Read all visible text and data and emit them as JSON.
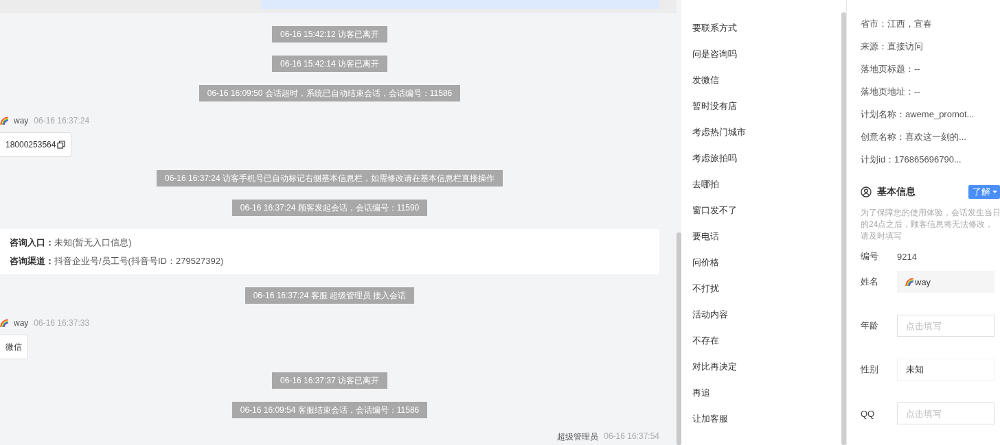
{
  "chat": {
    "messages": [
      {
        "kind": "system",
        "text": "06-16 15:42:12 访客已离开"
      },
      {
        "kind": "system",
        "text": "06-16 15:42:14 访客已离开"
      },
      {
        "kind": "system",
        "text": "06-16 16:09:50 会话超时，系统已自动结束会话，会话编号：11586"
      },
      {
        "kind": "visitor",
        "name": "way",
        "time": "06-16 16:37:24",
        "text": "18000253564",
        "copyable": true
      },
      {
        "kind": "system",
        "text": "06-16 16:37:24 访客手机号已自动标记右侧基本信息栏，如需修改请在基本信息栏直接操作"
      },
      {
        "kind": "system",
        "text": "06-16 16:37:24 顾客发起会话，会话编号：11590"
      },
      {
        "kind": "info",
        "rows": [
          {
            "label": "咨询入口：",
            "value": "未知(暂无入口信息)"
          },
          {
            "label": "咨询渠道：",
            "value": "抖音企业号/员工号(抖音号ID：279527392)"
          }
        ]
      },
      {
        "kind": "system",
        "text": "06-16 16:37:24 客服 超级管理员 接入会话"
      },
      {
        "kind": "visitor",
        "name": "way",
        "time": "06-16 16:37:33",
        "text": "微信",
        "copyable": false
      },
      {
        "kind": "system",
        "text": "06-16 16:37:37 访客已离开"
      },
      {
        "kind": "system",
        "text": "06-16 16:09:54 客服结束会话，会话编号：11586"
      },
      {
        "kind": "agent",
        "name": "超级管理员",
        "time": "06-16 16:37:54"
      }
    ]
  },
  "quick_replies": [
    "要联系方式",
    "问是咨询吗",
    "发微信",
    "暂时没有店",
    "考虑热门城市",
    "考虑旅拍吗",
    "去哪拍",
    "窗口发不了",
    "要电话",
    "问价格",
    "不打扰",
    "活动内容",
    "不存在",
    "对比再决定",
    "再追",
    "让加客服"
  ],
  "visit_info": [
    "省市：江西，宜春",
    "来源：直接访问",
    "落地页标题：--",
    "落地页地址：--",
    "计划名称：aweme_promot...",
    "创意名称：喜欢这一刻的...",
    "计划id：176865696790..."
  ],
  "basic_info": {
    "title": "基本信息",
    "learn_button": "了解",
    "notice": "为了保障您的使用体验，会话发生当日的24点之后，顾客信息将无法修改，请及时填写",
    "fields": [
      {
        "kind": "text",
        "label": "编号",
        "value": "9214"
      },
      {
        "kind": "readonly",
        "label": "姓名",
        "value": "way"
      },
      {
        "kind": "input",
        "label": "年龄",
        "placeholder": "点击填写"
      },
      {
        "kind": "select",
        "label": "性别",
        "value": "未知"
      },
      {
        "kind": "input",
        "label": "QQ",
        "placeholder": "点击填写"
      }
    ]
  }
}
